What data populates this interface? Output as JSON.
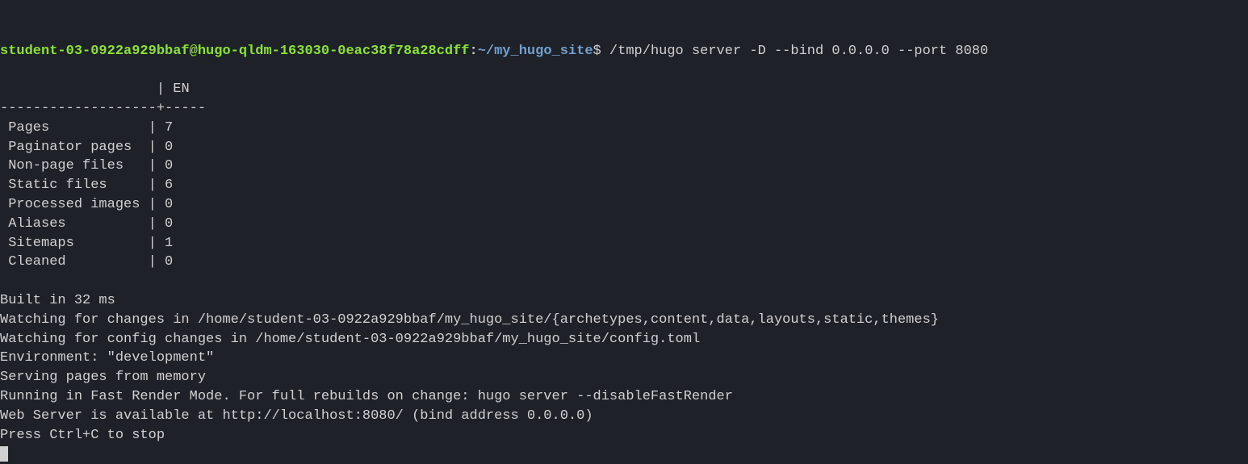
{
  "prompt": {
    "user_host": "student-03-0922a929bbaf@hugo-qldm-163030-0eac38f78a28cdff",
    "sep": ":",
    "path": "~/my_hugo_site",
    "dollar": "$"
  },
  "command": " /tmp/hugo server -D --bind 0.0.0.0 --port 8080",
  "table": {
    "header_prefix": "                   | ",
    "header_lang": "EN",
    "header_suffix": "  ",
    "divider": "-------------------+-----",
    "rows": [
      {
        "label": " Pages            ",
        "value": " 7"
      },
      {
        "label": " Paginator pages  ",
        "value": " 0"
      },
      {
        "label": " Non-page files   ",
        "value": " 0"
      },
      {
        "label": " Static files     ",
        "value": " 6"
      },
      {
        "label": " Processed images ",
        "value": " 0"
      },
      {
        "label": " Aliases          ",
        "value": " 0"
      },
      {
        "label": " Sitemaps         ",
        "value": " 1"
      },
      {
        "label": " Cleaned          ",
        "value": " 0"
      }
    ]
  },
  "status": {
    "built": "Built in 32 ms",
    "watching_changes": "Watching for changes in /home/student-03-0922a929bbaf/my_hugo_site/{archetypes,content,data,layouts,static,themes}",
    "watching_config": "Watching for config changes in /home/student-03-0922a929bbaf/my_hugo_site/config.toml",
    "environment": "Environment: \"development\"",
    "serving": "Serving pages from memory",
    "fast_render": "Running in Fast Render Mode. For full rebuilds on change: hugo server --disableFastRender",
    "webserver": "Web Server is available at http://localhost:8080/ (bind address 0.0.0.0)",
    "stop": "Press Ctrl+C to stop"
  }
}
